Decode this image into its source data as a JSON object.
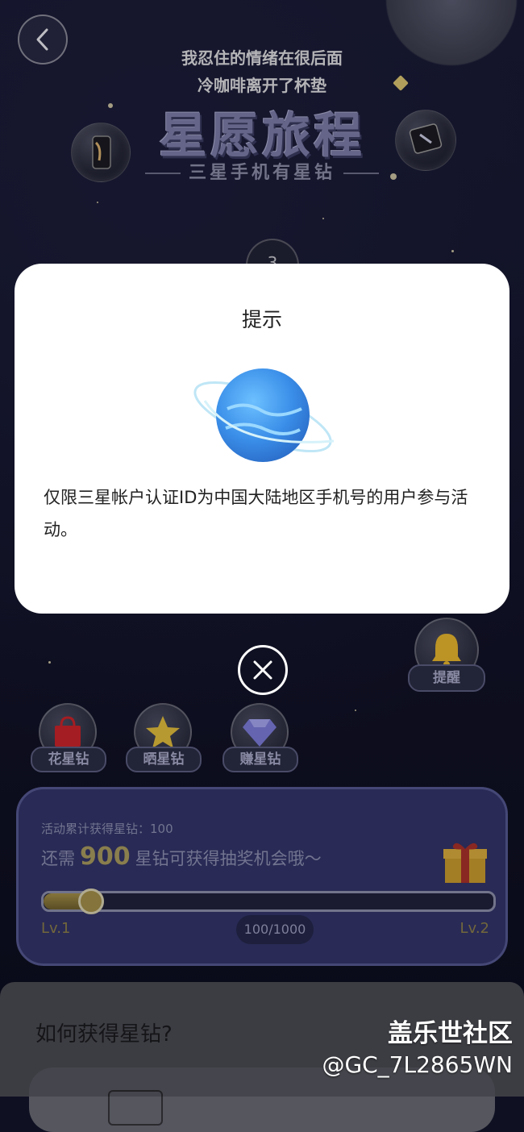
{
  "header": {
    "line1": "我忍住的情绪在很后面",
    "line2": "冷咖啡离开了杯垫",
    "logo_title": "星愿旅程",
    "logo_subtitle": "三星手机有星钻",
    "step_number": "3"
  },
  "dialog": {
    "title": "提示",
    "message": "仅限三星帐户认证ID为中国大陆地区手机号的用户参与活动。",
    "planet_icon": "planet-icon"
  },
  "actions": [
    {
      "label": "花星钻",
      "icon": "shopping-bag-icon",
      "color": "#c8242a"
    },
    {
      "label": "晒星钻",
      "icon": "star-icon",
      "color": "#e0bb3c"
    },
    {
      "label": "赚星钻",
      "icon": "diamond-icon",
      "color": "#7a7ad8"
    }
  ],
  "remind": {
    "label": "提醒",
    "icon": "bell-icon",
    "color": "#e6b52e"
  },
  "progress": {
    "accum_label": "活动累计获得星钻：100",
    "need_prefix": "还需",
    "need_number": "900",
    "need_suffix": "星钻可获得抽奖机会哦～",
    "level_start": "Lv.1",
    "level_end": "Lv.2",
    "count_text": "100/1000",
    "value": 0.1
  },
  "bottom": {
    "howto_title": "如何获得星钻?"
  },
  "watermark": {
    "brand": "盖乐世社区",
    "user": "@GC_7L2865WN"
  }
}
